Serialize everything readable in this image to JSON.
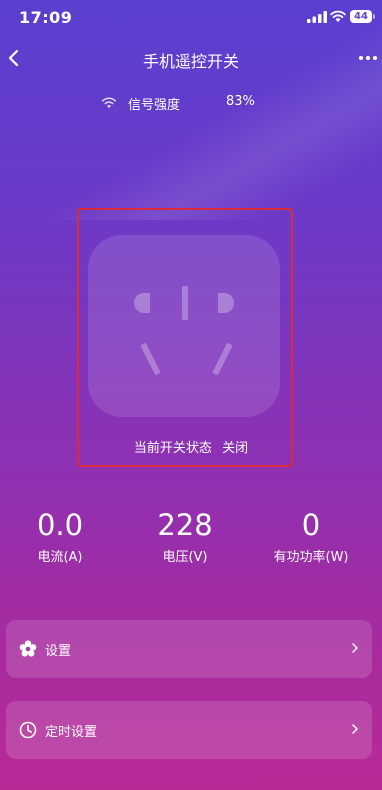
{
  "status_bar": {
    "time": "17:09",
    "battery": "44"
  },
  "nav": {
    "title": "手机遥控开关"
  },
  "signal": {
    "label": "信号强度",
    "value": "83%"
  },
  "switch": {
    "state_label": "当前开关状态",
    "state_value": "关闭"
  },
  "metrics": [
    {
      "value": "0.0",
      "label": "电流(A)"
    },
    {
      "value": "228",
      "label": "电压(V)"
    },
    {
      "value": "0",
      "label": "有功功率(W)"
    }
  ],
  "menu": [
    {
      "label": "设置",
      "icon": "flower-gear-icon"
    },
    {
      "label": "定时设置",
      "icon": "clock-icon"
    }
  ],
  "colors": {
    "highlight": "#d92a3e",
    "gradient_top": "#5b3fcf",
    "gradient_bottom": "#b82a96"
  }
}
